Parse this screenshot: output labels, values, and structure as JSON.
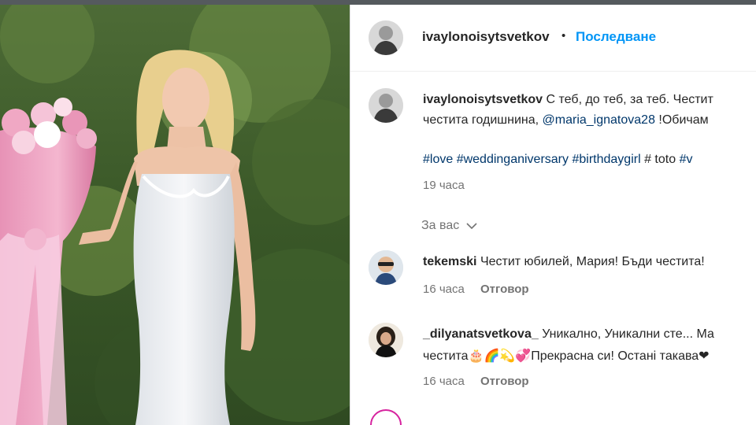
{
  "post": {
    "author": "ivaylonoisytsvetkov",
    "dot": "•",
    "follow_label": "Последване"
  },
  "caption": {
    "username": "ivaylonoisytsvetkov",
    "line1": "С теб, до теб, за теб. Честит",
    "line2_prefix": "честита годишнина, ",
    "mention": "@maria_ignatova28",
    "line2_suffix": " !Обичам",
    "hashtags": [
      "#love",
      "#weddinganiversary",
      "#birthdaygirl"
    ],
    "hashtag_extra": "# toto",
    "hashtag_tail": "#v",
    "time": "19 часа"
  },
  "filter": {
    "label": "За вас",
    "chevron_icon": "chevron-down-icon"
  },
  "comments": [
    {
      "username": "tekemski",
      "text": "Честит юбилей, Мария! Бъди честита!",
      "time": "16 часа",
      "reply_label": "Отговор"
    },
    {
      "username": "_dilyanatsvetkova_",
      "text_line1": "Уникално, Уникални сте... Ма",
      "text_line2": "честита🎂🌈💫💞Прекрасна си! Останi такава❤",
      "time": "16 часа",
      "reply_label": "Отговор"
    }
  ],
  "colors": {
    "link_blue": "#00376b",
    "follow_blue": "#0095f6",
    "meta_gray": "#737373"
  }
}
